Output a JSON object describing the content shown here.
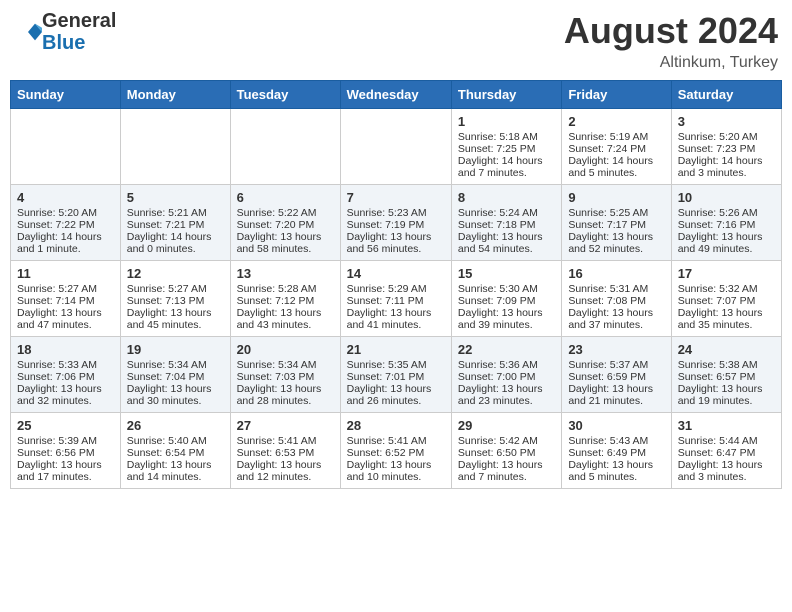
{
  "header": {
    "logo_line1": "General",
    "logo_line2": "Blue",
    "month": "August 2024",
    "location": "Altinkum, Turkey"
  },
  "weekdays": [
    "Sunday",
    "Monday",
    "Tuesday",
    "Wednesday",
    "Thursday",
    "Friday",
    "Saturday"
  ],
  "weeks": [
    [
      {
        "day": "",
        "text": ""
      },
      {
        "day": "",
        "text": ""
      },
      {
        "day": "",
        "text": ""
      },
      {
        "day": "",
        "text": ""
      },
      {
        "day": "1",
        "text": "Sunrise: 5:18 AM\nSunset: 7:25 PM\nDaylight: 14 hours\nand 7 minutes."
      },
      {
        "day": "2",
        "text": "Sunrise: 5:19 AM\nSunset: 7:24 PM\nDaylight: 14 hours\nand 5 minutes."
      },
      {
        "day": "3",
        "text": "Sunrise: 5:20 AM\nSunset: 7:23 PM\nDaylight: 14 hours\nand 3 minutes."
      }
    ],
    [
      {
        "day": "4",
        "text": "Sunrise: 5:20 AM\nSunset: 7:22 PM\nDaylight: 14 hours\nand 1 minute."
      },
      {
        "day": "5",
        "text": "Sunrise: 5:21 AM\nSunset: 7:21 PM\nDaylight: 14 hours\nand 0 minutes."
      },
      {
        "day": "6",
        "text": "Sunrise: 5:22 AM\nSunset: 7:20 PM\nDaylight: 13 hours\nand 58 minutes."
      },
      {
        "day": "7",
        "text": "Sunrise: 5:23 AM\nSunset: 7:19 PM\nDaylight: 13 hours\nand 56 minutes."
      },
      {
        "day": "8",
        "text": "Sunrise: 5:24 AM\nSunset: 7:18 PM\nDaylight: 13 hours\nand 54 minutes."
      },
      {
        "day": "9",
        "text": "Sunrise: 5:25 AM\nSunset: 7:17 PM\nDaylight: 13 hours\nand 52 minutes."
      },
      {
        "day": "10",
        "text": "Sunrise: 5:26 AM\nSunset: 7:16 PM\nDaylight: 13 hours\nand 49 minutes."
      }
    ],
    [
      {
        "day": "11",
        "text": "Sunrise: 5:27 AM\nSunset: 7:14 PM\nDaylight: 13 hours\nand 47 minutes."
      },
      {
        "day": "12",
        "text": "Sunrise: 5:27 AM\nSunset: 7:13 PM\nDaylight: 13 hours\nand 45 minutes."
      },
      {
        "day": "13",
        "text": "Sunrise: 5:28 AM\nSunset: 7:12 PM\nDaylight: 13 hours\nand 43 minutes."
      },
      {
        "day": "14",
        "text": "Sunrise: 5:29 AM\nSunset: 7:11 PM\nDaylight: 13 hours\nand 41 minutes."
      },
      {
        "day": "15",
        "text": "Sunrise: 5:30 AM\nSunset: 7:09 PM\nDaylight: 13 hours\nand 39 minutes."
      },
      {
        "day": "16",
        "text": "Sunrise: 5:31 AM\nSunset: 7:08 PM\nDaylight: 13 hours\nand 37 minutes."
      },
      {
        "day": "17",
        "text": "Sunrise: 5:32 AM\nSunset: 7:07 PM\nDaylight: 13 hours\nand 35 minutes."
      }
    ],
    [
      {
        "day": "18",
        "text": "Sunrise: 5:33 AM\nSunset: 7:06 PM\nDaylight: 13 hours\nand 32 minutes."
      },
      {
        "day": "19",
        "text": "Sunrise: 5:34 AM\nSunset: 7:04 PM\nDaylight: 13 hours\nand 30 minutes."
      },
      {
        "day": "20",
        "text": "Sunrise: 5:34 AM\nSunset: 7:03 PM\nDaylight: 13 hours\nand 28 minutes."
      },
      {
        "day": "21",
        "text": "Sunrise: 5:35 AM\nSunset: 7:01 PM\nDaylight: 13 hours\nand 26 minutes."
      },
      {
        "day": "22",
        "text": "Sunrise: 5:36 AM\nSunset: 7:00 PM\nDaylight: 13 hours\nand 23 minutes."
      },
      {
        "day": "23",
        "text": "Sunrise: 5:37 AM\nSunset: 6:59 PM\nDaylight: 13 hours\nand 21 minutes."
      },
      {
        "day": "24",
        "text": "Sunrise: 5:38 AM\nSunset: 6:57 PM\nDaylight: 13 hours\nand 19 minutes."
      }
    ],
    [
      {
        "day": "25",
        "text": "Sunrise: 5:39 AM\nSunset: 6:56 PM\nDaylight: 13 hours\nand 17 minutes."
      },
      {
        "day": "26",
        "text": "Sunrise: 5:40 AM\nSunset: 6:54 PM\nDaylight: 13 hours\nand 14 minutes."
      },
      {
        "day": "27",
        "text": "Sunrise: 5:41 AM\nSunset: 6:53 PM\nDaylight: 13 hours\nand 12 minutes."
      },
      {
        "day": "28",
        "text": "Sunrise: 5:41 AM\nSunset: 6:52 PM\nDaylight: 13 hours\nand 10 minutes."
      },
      {
        "day": "29",
        "text": "Sunrise: 5:42 AM\nSunset: 6:50 PM\nDaylight: 13 hours\nand 7 minutes."
      },
      {
        "day": "30",
        "text": "Sunrise: 5:43 AM\nSunset: 6:49 PM\nDaylight: 13 hours\nand 5 minutes."
      },
      {
        "day": "31",
        "text": "Sunrise: 5:44 AM\nSunset: 6:47 PM\nDaylight: 13 hours\nand 3 minutes."
      }
    ]
  ]
}
